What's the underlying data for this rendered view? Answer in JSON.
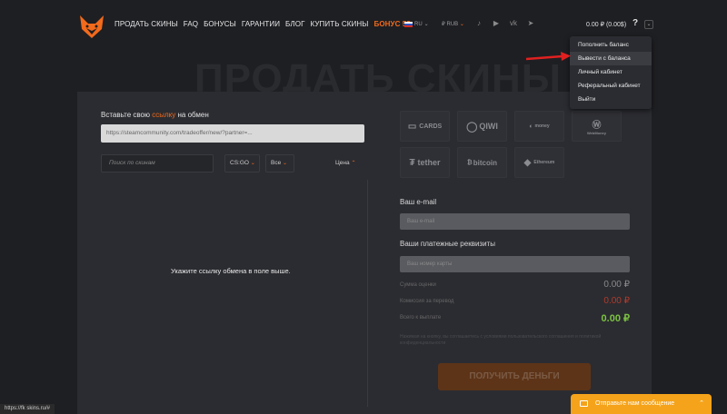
{
  "header": {
    "nav": [
      "ПРОДАТЬ СКИНЫ",
      "FAQ",
      "БОНУСЫ",
      "ГАРАНТИИ",
      "БЛОГ",
      "КУПИТЬ СКИНЫ",
      "БОНУС 5$"
    ],
    "lang": "RU",
    "currency": "₽ RUB",
    "balance": "0.00 ₽ (0.00$)",
    "help": "?"
  },
  "dropdown": {
    "items": [
      "Пополнить баланс",
      "Вывести с баланса",
      "Личный кабинет",
      "Реферальный кабинет",
      "Выйти"
    ]
  },
  "hero_title": "ПРОДАТЬ СКИНЫ",
  "left": {
    "offer_label_pre": "Вставьте свою ",
    "offer_label_link": "ссылку",
    "offer_label_post": " на обмен",
    "offer_value": "https://steamcommunity.com/tradeoffer/new/?partner=...",
    "search_placeholder": "Поиск по скинам",
    "game": "CS:GO",
    "filter": "Все",
    "sort": "Цена",
    "empty_message": "Укажите ссылку обмена в поле выше."
  },
  "payments": [
    "CARDS",
    "QIWI",
    "money",
    "WebMoney",
    "tether",
    "bitcoin",
    "Ethereum"
  ],
  "right": {
    "email_label": "Ваш e-mail",
    "email_placeholder": "Ваш e-mail",
    "req_label": "Ваши платежные реквизиты",
    "req_placeholder": "Ваш номер карты",
    "rows": [
      {
        "label": "Сумма оценки",
        "value": "0.00 ₽",
        "color": "#8a8a8a"
      },
      {
        "label": "Комиссия за перевод",
        "value": "0.00 ₽",
        "color": "#b33a2a"
      },
      {
        "label": "Всего к выплате",
        "value": "0.00 ₽",
        "color": "#7cc242"
      }
    ],
    "fine_print": "Нажимая на кнопку, вы соглашаетесь с условиями пользовательского соглашения и политикой конфиденциальности",
    "button": "ПОЛУЧИТЬ ДЕНЬГИ"
  },
  "chat": {
    "label": "Отправьте нам сообщение",
    "close": "⌃"
  },
  "status_url": "https://fk skins.ru/#"
}
